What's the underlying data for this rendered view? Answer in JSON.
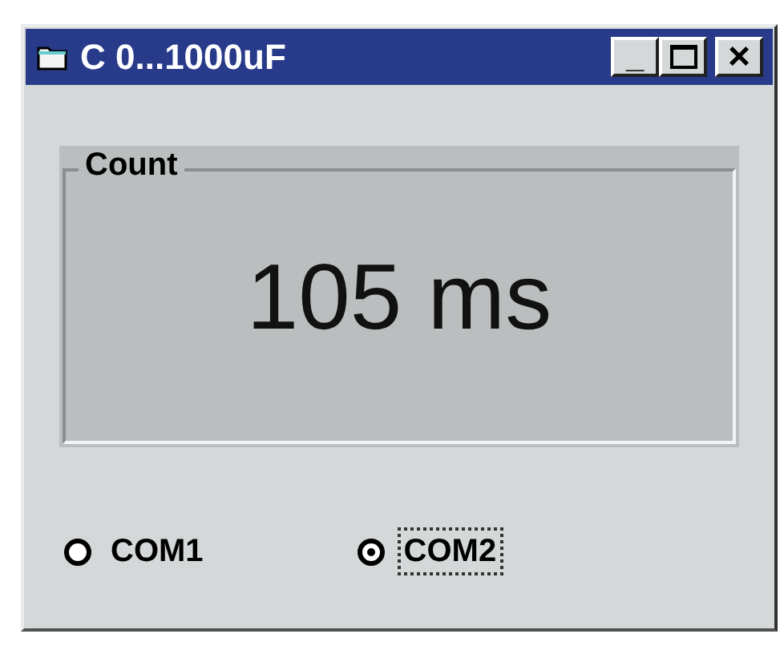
{
  "window": {
    "title": "C 0...1000uF"
  },
  "title_buttons": [
    {
      "kind": "minimize",
      "label": "_"
    },
    {
      "kind": "maximize"
    },
    {
      "kind": "close",
      "label": "×"
    }
  ],
  "group": {
    "label": "Count",
    "value": "105 ms"
  },
  "radios": [
    {
      "label": "COM1",
      "selected": false,
      "focused": false
    },
    {
      "label": "COM2",
      "selected": true,
      "focused": true
    }
  ]
}
